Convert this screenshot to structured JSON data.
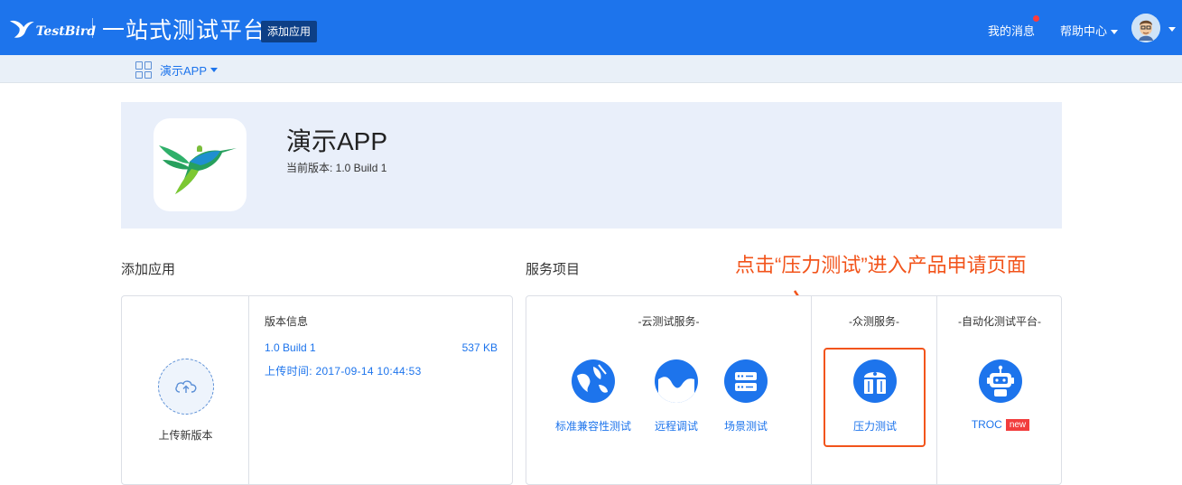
{
  "header": {
    "logo_text": "TestBird",
    "platform_title": "一站式测试平台",
    "add_app_button": "添加应用",
    "messages_label": "我的消息",
    "help_label": "帮助中心"
  },
  "subbar": {
    "app_name": "演示APP"
  },
  "banner": {
    "app_name": "演示APP",
    "current_version": "当前版本: 1.0 Build 1"
  },
  "sections": {
    "add_app_title": "添加应用",
    "services_title": "服务项目",
    "annotation": "点击“压力测试”进入产品申请页面"
  },
  "upload": {
    "label": "上传新版本"
  },
  "version_info": {
    "title": "版本信息",
    "name": "1.0 Build 1",
    "size": "537 KB",
    "upload_time": "上传时间:  2017-09-14 10:44:53"
  },
  "services": {
    "cloud_title": "-云测试服务-",
    "crowd_title": "-众测服务-",
    "auto_title": "-自动化测试平台-",
    "items": [
      {
        "label": "标准兼容性测试",
        "icon": "globe-icon"
      },
      {
        "label": "远程调试",
        "icon": "wave-icon"
      },
      {
        "label": "场景测试",
        "icon": "server-icon"
      },
      {
        "label": "压力测试",
        "icon": "pressure-icon"
      },
      {
        "label": "TROC",
        "icon": "robot-icon",
        "badge": "new"
      }
    ]
  },
  "colors": {
    "primary": "#1d74ec",
    "annotation": "#f2541b",
    "badge": "#f23d3d"
  }
}
